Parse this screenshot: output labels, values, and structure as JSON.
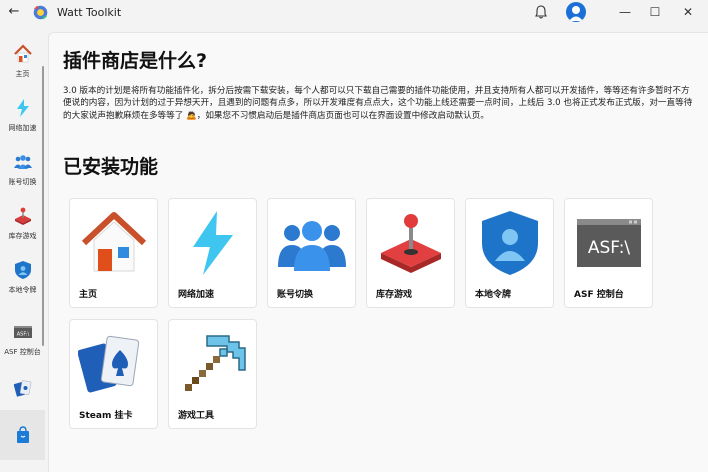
{
  "window": {
    "title": "Watt Toolkit",
    "controls": {
      "minimize": "—",
      "maximize": "☐",
      "close": "✕"
    }
  },
  "sidebar": {
    "items": [
      {
        "label": "主页",
        "icon": "home-icon"
      },
      {
        "label": "网络加速",
        "icon": "lightning-icon"
      },
      {
        "label": "账号切换",
        "icon": "users-icon"
      },
      {
        "label": "库存游戏",
        "icon": "joystick-icon"
      },
      {
        "label": "本地令牌",
        "icon": "shield-user-icon"
      },
      {
        "label": "ASF 控制台",
        "icon": "asf-console-icon"
      },
      {
        "label": "",
        "icon": "cards-icon"
      },
      {
        "label": "",
        "icon": "store-bag-icon"
      }
    ]
  },
  "main": {
    "heading": "插件商店是什么?",
    "paragraph": "3.0 版本的计划是将所有功能插件化，拆分后按需下载安装，每个人都可以只下载自己需要的插件功能使用，并且支持所有人都可以开发插件，等等还有许多暂时不方便说的内容，因为计划的过于异想天开，且遇到的问题有点多，所以开发难度有点点大，这个功能上线还需要一点时间，上线后 3.0 也将正式发布正式版，对一直等待的大家说声抱歉麻烦在多等等了 🙇，如果您不习惯启动后是插件商店页面也可以在界面设置中修改启动默认页。",
    "installed_heading": "已安装功能",
    "plugins": [
      {
        "label": "主页",
        "icon": "home-icon"
      },
      {
        "label": "网络加速",
        "icon": "lightning-icon"
      },
      {
        "label": "账号切换",
        "icon": "users-icon"
      },
      {
        "label": "库存游戏",
        "icon": "joystick-icon"
      },
      {
        "label": "本地令牌",
        "icon": "shield-user-icon"
      },
      {
        "label": "ASF 控制台",
        "icon": "asf-console-icon",
        "art_text": "ASF:\\"
      },
      {
        "label": "Steam 挂卡",
        "icon": "cards-icon"
      },
      {
        "label": "游戏工具",
        "icon": "pickaxe-icon"
      }
    ]
  },
  "colors": {
    "accent": "#1d6fd8",
    "lightning": "#3ec6f0",
    "red": "#d93a3a",
    "asf_bg": "#5a5a5a"
  }
}
